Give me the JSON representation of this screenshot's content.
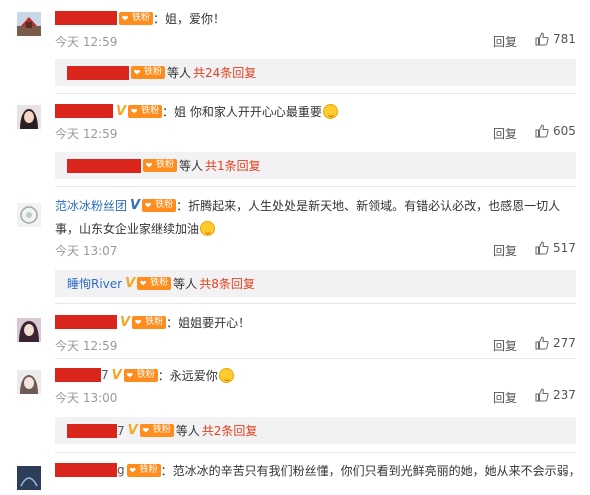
{
  "common": {
    "fan_badge": "铁粉",
    "vip_mark": "V",
    "reply_label": "回复",
    "others_label": "等人"
  },
  "comments": [
    {
      "name": "",
      "text": "：姐，爱你！",
      "time": "今天 12:59",
      "likes": "781",
      "replies": "共24条回复"
    },
    {
      "name": "",
      "text": "：姐 你和家人开开心心最重要",
      "time": "今天 12:59",
      "likes": "605",
      "replies": "共1条回复"
    },
    {
      "name": "范冰冰粉丝团",
      "text_line1": "：折腾起来，人生处处是新天地、新领域。有错必认必改，也感恩一切人",
      "text_line2": "事，山东女企业家继续加油",
      "time": "今天 13:07",
      "likes": "517",
      "reply_user": "睡恂River",
      "replies": "共8条回复"
    },
    {
      "name": "",
      "text": "：姐姐要开心！",
      "time": "今天 12:59",
      "likes": "277"
    },
    {
      "name": "7",
      "text": "：永远爱你",
      "time": "今天 13:00",
      "likes": "237",
      "reply_user": "7",
      "replies": "共2条回复"
    },
    {
      "name": "g",
      "text": "：范冰冰的辛苦只有我们粉丝懂，你们只看到光鲜亮丽的她，她从来不会示弱，"
    }
  ]
}
